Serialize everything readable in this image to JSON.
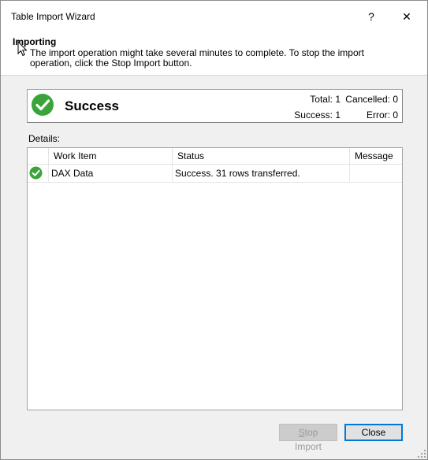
{
  "window": {
    "title": "Table Import Wizard",
    "help_glyph": "?",
    "close_glyph": "✕"
  },
  "header": {
    "title": "Importing",
    "description": "The import operation might take several minutes to complete. To stop the import operation, click the Stop Import button."
  },
  "status": {
    "icon": "success-check-icon",
    "text": "Success",
    "total": "Total: 1",
    "cancelled": "Cancelled: 0",
    "success": "Success: 1",
    "error": "Error: 0",
    "accent_color": "#3aa43a"
  },
  "details": {
    "label": "Details:",
    "columns": [
      "",
      "Work Item",
      "Status",
      "Message"
    ],
    "rows": [
      {
        "icon": "success-check-icon",
        "work_item": "DAX Data",
        "status": "Success. 31 rows transferred.",
        "message": ""
      }
    ]
  },
  "buttons": {
    "stop_accel": "S",
    "stop_rest": "top Import",
    "close": "Close",
    "focus_color": "#0078d7"
  }
}
